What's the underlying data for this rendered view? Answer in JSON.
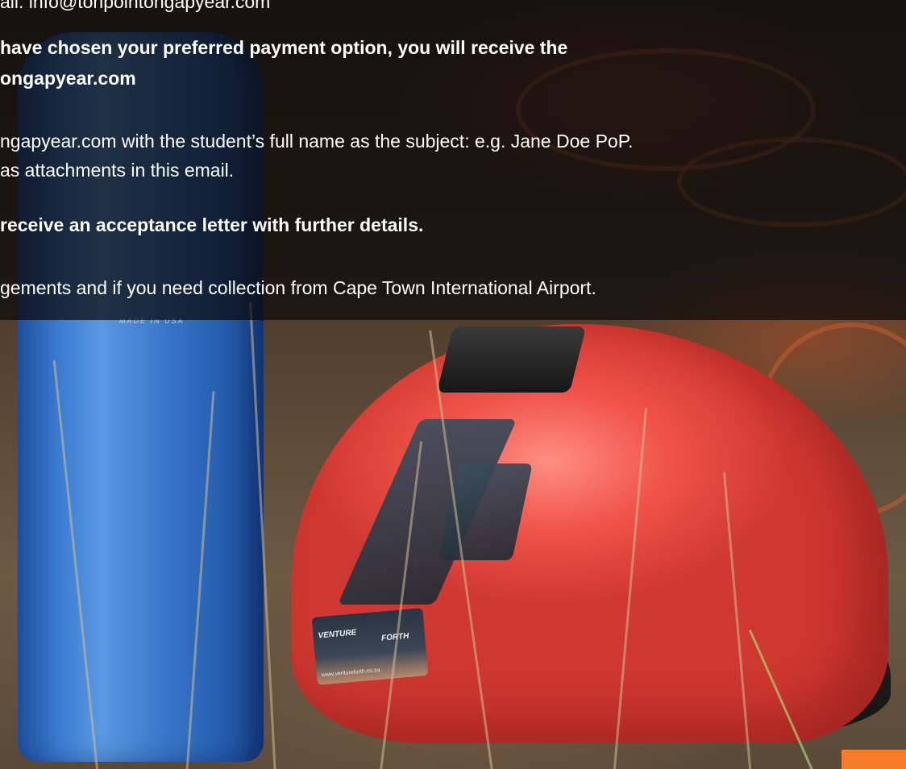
{
  "overlay": {
    "lines": [
      "ail: info@tonpointongapyear.com",
      "have chosen your preferred payment option, you will receive the",
      "ongapyear.com",
      "ngapyear.com with the student’s full name as the subject: e.g. Jane Doe PoP.",
      "as attachments in this email.",
      "receive an acceptance letter with further details.",
      "gements and if you need collection from Cape Town International Airport."
    ]
  },
  "photo": {
    "bottle_label": "MADE IN USA",
    "sticker_left": "VENTURE",
    "sticker_right": "FORTH",
    "sticker_url": "www.ventureforth.co.za"
  },
  "colors": {
    "accent_orange": "#f47c2a",
    "helmet_red": "#f0534a",
    "bottle_blue": "#3d7ed4"
  }
}
